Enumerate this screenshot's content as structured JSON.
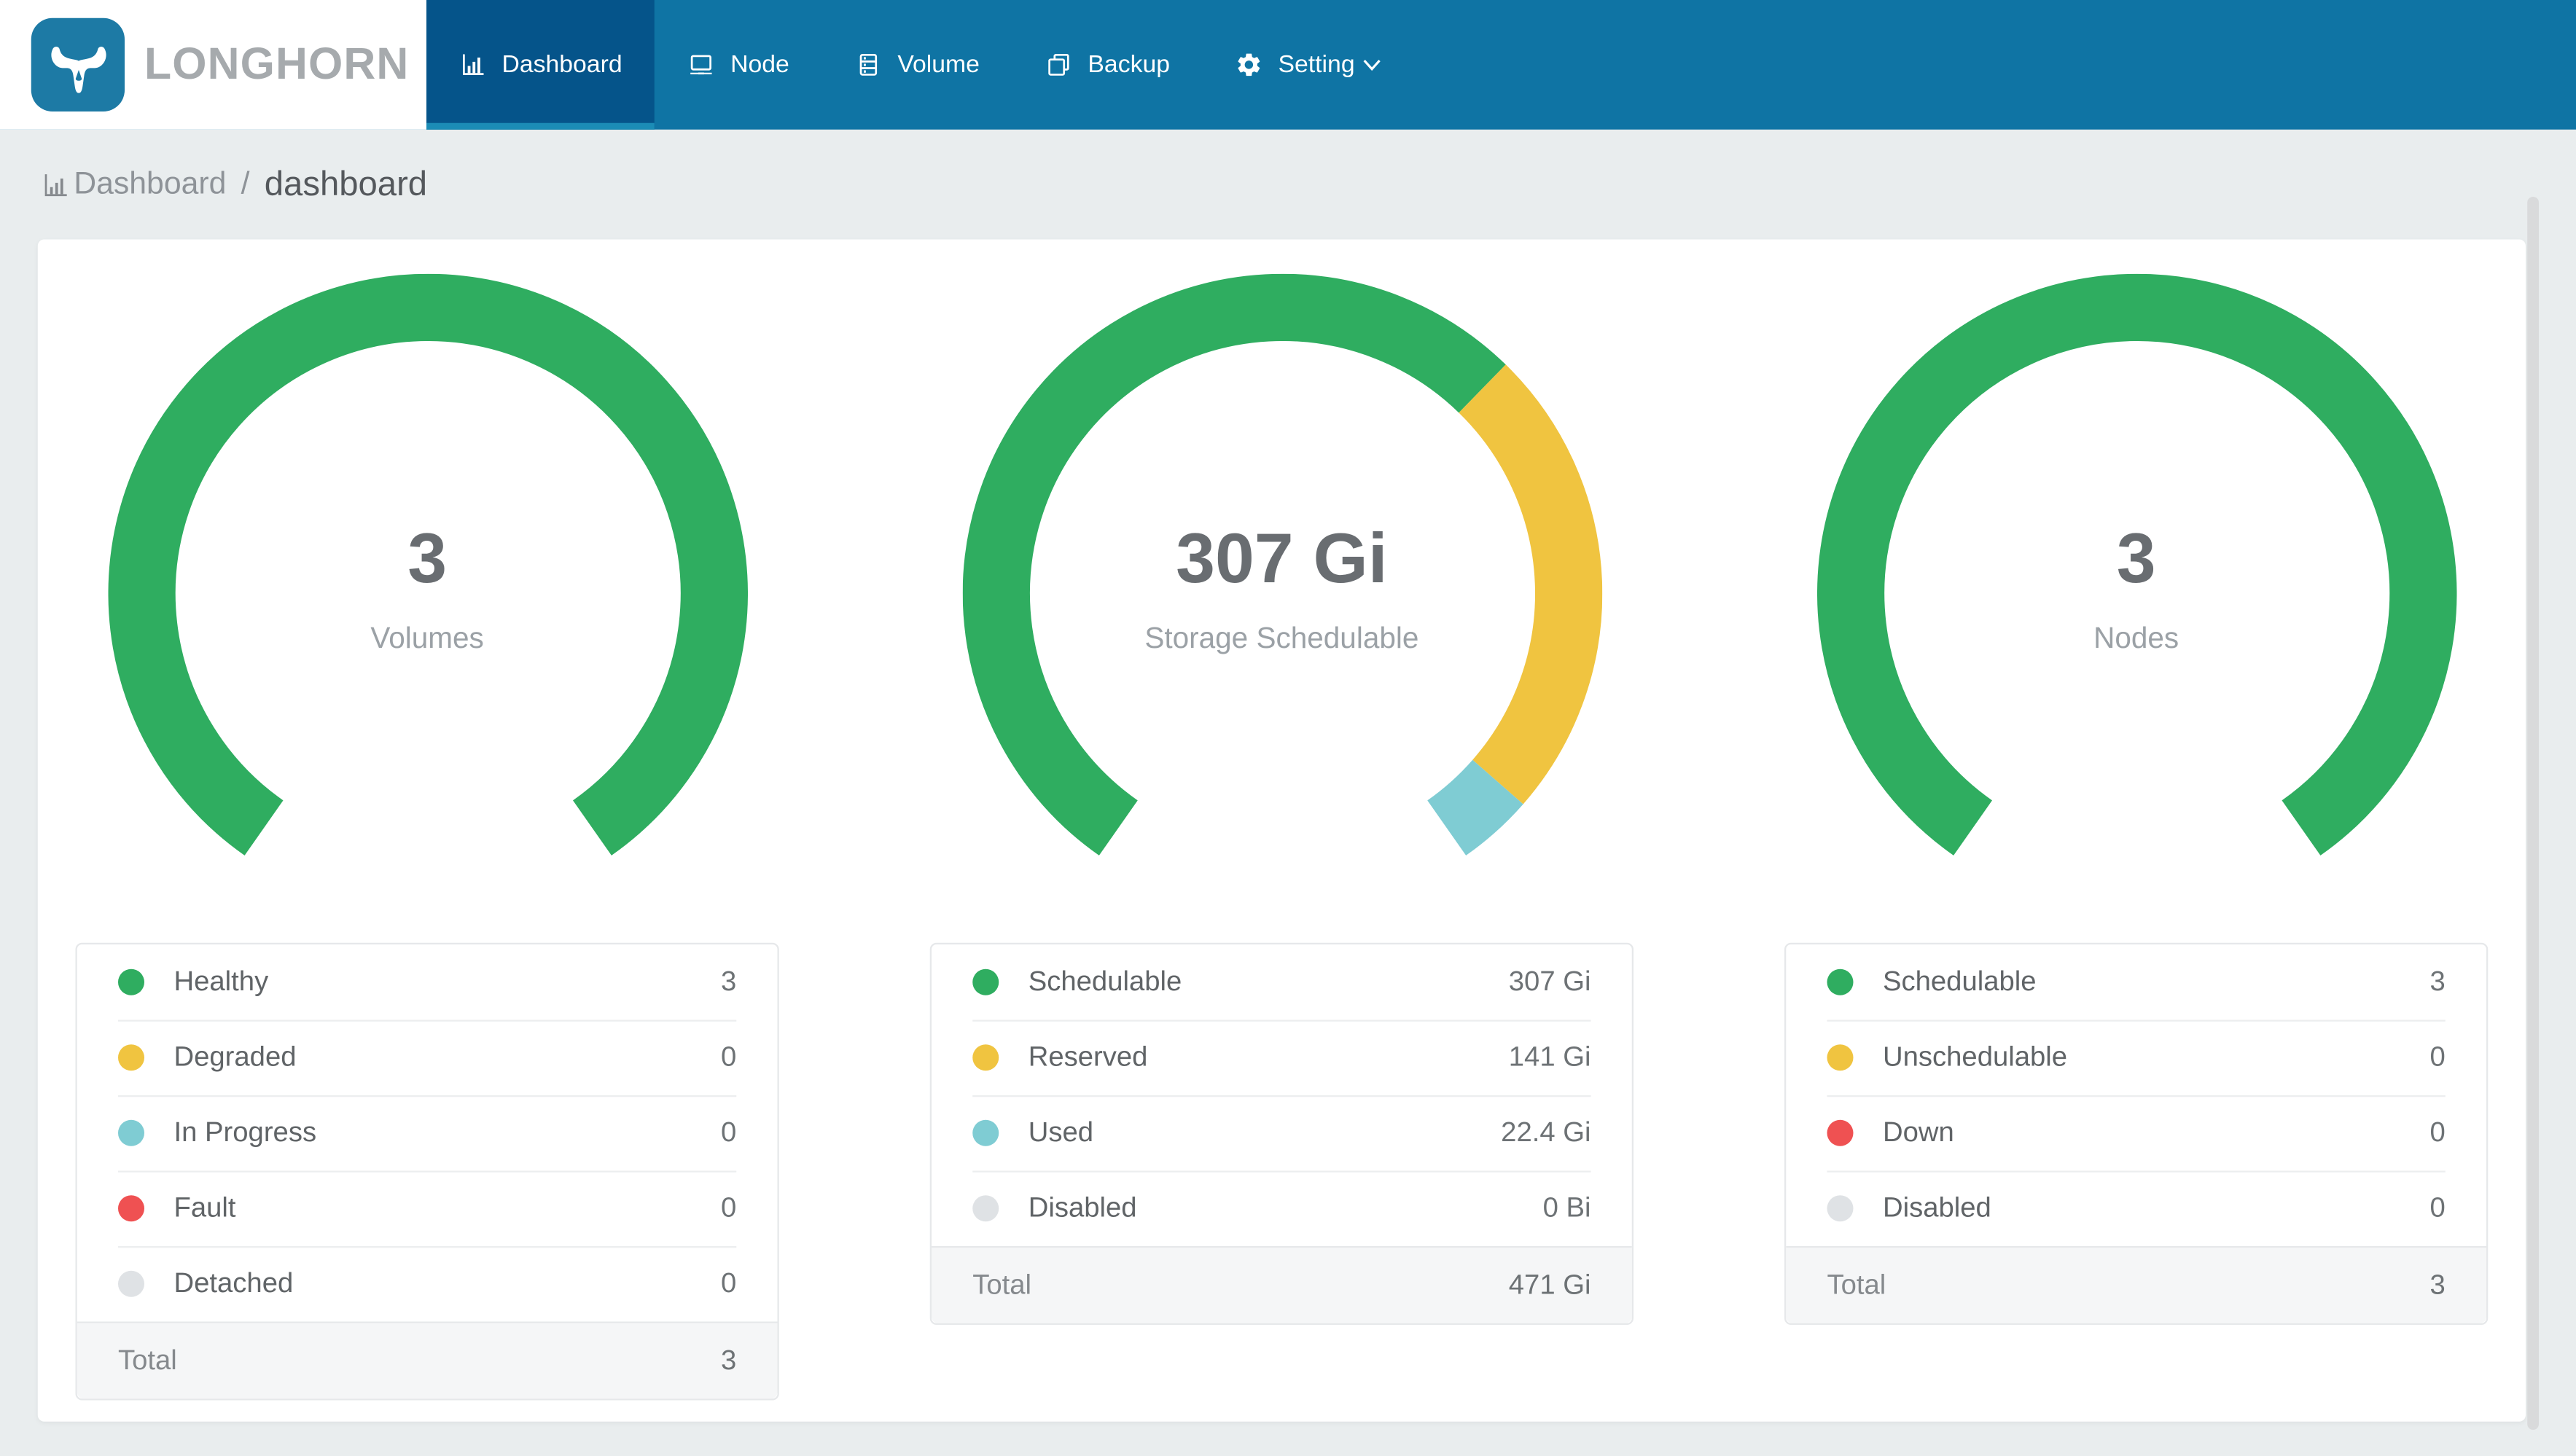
{
  "brand": {
    "name": "LONGHORN"
  },
  "nav": {
    "items": [
      {
        "label": "Dashboard",
        "icon": "bar-chart-icon",
        "active": true
      },
      {
        "label": "Node",
        "icon": "laptop-icon",
        "active": false
      },
      {
        "label": "Volume",
        "icon": "database-icon",
        "active": false
      },
      {
        "label": "Backup",
        "icon": "copy-icon",
        "active": false
      },
      {
        "label": "Setting",
        "icon": "gear-icon",
        "active": false,
        "dropdown": true
      }
    ]
  },
  "breadcrumb": {
    "section": "Dashboard",
    "separator": "/",
    "page": "dashboard"
  },
  "colors": {
    "navbar": "#0f74a4",
    "navbar_active": "#05548a",
    "indicator": "#1b8cb6",
    "logo_blue": "#1d7aa5",
    "page_bg": "#e9edee",
    "green": "#2fad60",
    "yellow": "#f0c440",
    "teal": "#7fccd3",
    "red": "#ef5152",
    "gray": "#dfe2e5"
  },
  "chart_data": [
    {
      "type": "donut-gauge",
      "center_value": "3",
      "center_label": "Volumes",
      "total_sweep_deg": 290,
      "segments": [
        {
          "label": "Healthy",
          "value": 3,
          "display": "3",
          "color": "#2fad60"
        },
        {
          "label": "Degraded",
          "value": 0,
          "display": "0",
          "color": "#f0c440"
        },
        {
          "label": "In Progress",
          "value": 0,
          "display": "0",
          "color": "#7fccd3"
        },
        {
          "label": "Fault",
          "value": 0,
          "display": "0",
          "color": "#ef5152"
        },
        {
          "label": "Detached",
          "value": 0,
          "display": "0",
          "color": "#dfe2e5"
        }
      ],
      "total": {
        "label": "Total",
        "display": "3"
      }
    },
    {
      "type": "donut-gauge",
      "center_value": "307 Gi",
      "center_label": "Storage Schedulable",
      "total_sweep_deg": 290,
      "segments": [
        {
          "label": "Schedulable",
          "value": 307,
          "display": "307 Gi",
          "color": "#2fad60"
        },
        {
          "label": "Reserved",
          "value": 141,
          "display": "141 Gi",
          "color": "#f0c440"
        },
        {
          "label": "Used",
          "value": 22.4,
          "display": "22.4 Gi",
          "color": "#7fccd3"
        },
        {
          "label": "Disabled",
          "value": 0,
          "display": "0 Bi",
          "color": "#dfe2e5"
        }
      ],
      "total": {
        "label": "Total",
        "display": "471 Gi"
      }
    },
    {
      "type": "donut-gauge",
      "center_value": "3",
      "center_label": "Nodes",
      "total_sweep_deg": 290,
      "segments": [
        {
          "label": "Schedulable",
          "value": 3,
          "display": "3",
          "color": "#2fad60"
        },
        {
          "label": "Unschedulable",
          "value": 0,
          "display": "0",
          "color": "#f0c440"
        },
        {
          "label": "Down",
          "value": 0,
          "display": "0",
          "color": "#ef5152"
        },
        {
          "label": "Disabled",
          "value": 0,
          "display": "0",
          "color": "#dfe2e5"
        }
      ],
      "total": {
        "label": "Total",
        "display": "3"
      }
    }
  ]
}
